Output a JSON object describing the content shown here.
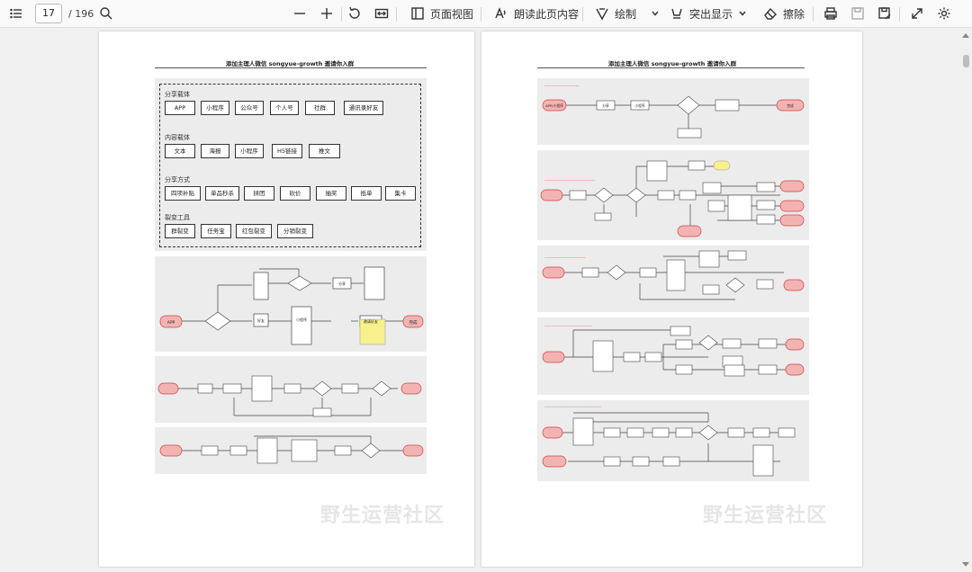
{
  "toolbar": {
    "current_page": "17",
    "total_pages": "/ 196",
    "page_view_label": "页面视图",
    "read_aloud_label": "朗读此页内容",
    "draw_label": "绘制",
    "highlight_label": "突出显示",
    "erase_label": "擦除"
  },
  "left_page": {
    "title": "添加主理人微信 songyue-growth 邀请你入群",
    "watermark": "野生运营社区",
    "share_carriers": {
      "label": "分享载体",
      "items": [
        "APP",
        "小程序",
        "公众号",
        "个人号",
        "社群",
        "通讯录好友"
      ]
    },
    "content_carriers": {
      "label": "内容载体",
      "items": [
        "文本",
        "海报",
        "小程序",
        "H5链接",
        "推文"
      ]
    },
    "share_methods": {
      "label": "分享方式",
      "items": [
        "四项补贴",
        "单品秒杀",
        "拼团",
        "砍价",
        "抽奖",
        "抵单",
        "集卡"
      ]
    },
    "fission_tools": {
      "label": "裂变工具",
      "items": [
        "群裂变",
        "任务宝",
        "红包裂变",
        "分销裂变"
      ]
    },
    "flow_nodes": {
      "app": "APP",
      "friend": "好友",
      "invite_friend": "邀请好友",
      "mini_program": "小程序",
      "share": "分享",
      "complete": "完成"
    }
  },
  "right_page": {
    "title": "添加主理人微信 songyue-growth 邀请你入群",
    "watermark": "野生运营社区",
    "flow_nodes": {
      "app_mini": "APP/小程序",
      "mini_program": "小程序",
      "share": "分享",
      "complete": "完成"
    }
  }
}
